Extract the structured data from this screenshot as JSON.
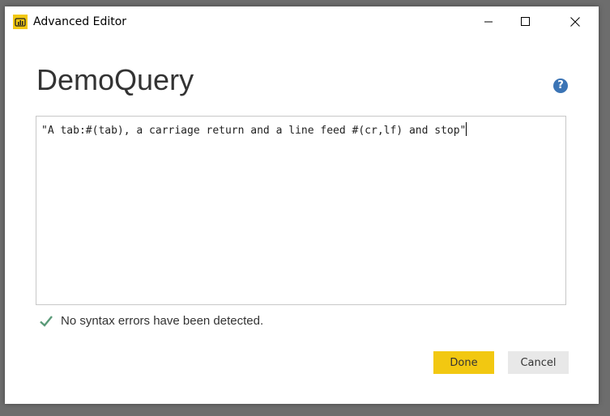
{
  "window": {
    "title": "Advanced Editor",
    "app_icon": "power-bi-icon",
    "controls": [
      "minimize-icon",
      "maximize-icon",
      "close-icon"
    ]
  },
  "query_name": "DemoQuery",
  "help_label": "?",
  "editor": {
    "code": "\"A tab:#(tab), a carriage return and a line feed #(cr,lf) and stop\""
  },
  "status": {
    "icon": "checkmark-icon",
    "text": "No syntax errors have been detected."
  },
  "buttons": {
    "done": "Done",
    "cancel": "Cancel"
  },
  "colors": {
    "accent": "#f2c811",
    "help": "#3b74b5",
    "check": "#5a9a78"
  }
}
